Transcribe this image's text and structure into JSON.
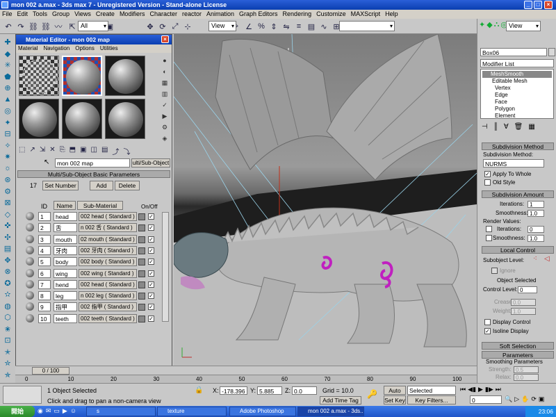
{
  "window": {
    "title": "mon 002 a.max - 3ds max 7 - Unregistered Version - Stand-alone License",
    "minimize": "_",
    "maximize": "□",
    "close": "×"
  },
  "menu": [
    "File",
    "Edit",
    "Tools",
    "Group",
    "Views",
    "Create",
    "Modifiers",
    "Character",
    "reactor",
    "Animation",
    "Graph Editors",
    "Rendering",
    "Customize",
    "MAXScript",
    "Help"
  ],
  "toolbar": {
    "selection_filter": "All",
    "reference_coord": "View",
    "named_selection": "",
    "right_view": "View",
    "icons": [
      "undo-icon",
      "redo-icon",
      "link-icon",
      "unlink-icon",
      "bind-space-warp-icon",
      "select-icon",
      "select-by-name-icon",
      "region-select-icon",
      "window-crossing-icon",
      "select-move-icon",
      "select-rotate-icon",
      "select-scale-icon",
      "pivot-icon",
      "select-manipulate-icon",
      "snap-icon",
      "angle-snap-icon",
      "percent-snap-icon",
      "spinner-snap-icon",
      "mirror-icon",
      "align-icon",
      "layer-manager-icon",
      "curve-editor-icon",
      "schematic-view-icon",
      "material-editor-icon",
      "render-scene-icon",
      "quick-render-icon"
    ]
  },
  "left_toolbar": [
    "tool-1",
    "tool-2",
    "tool-3",
    "tool-4",
    "tool-5",
    "tool-6",
    "tool-7",
    "tool-8",
    "tool-9",
    "tool-10",
    "tool-11",
    "tool-12",
    "tool-13",
    "tool-14",
    "tool-15",
    "tool-16",
    "tool-17",
    "tool-18",
    "tool-19",
    "tool-20",
    "tool-21",
    "tool-22",
    "tool-23",
    "tool-24",
    "tool-25",
    "tool-26",
    "tool-27",
    "tool-28",
    "tool-29",
    "tool-30"
  ],
  "material_editor": {
    "title": "Material Editor - mon 002 map",
    "menu": [
      "Material",
      "Navigation",
      "Options",
      "Utilities"
    ],
    "material_name": "mon 002 map",
    "material_type": "ulti/Sub-Object",
    "rollout": "Multi/Sub-Object Basic Parameters",
    "count": "17",
    "set_number": "Set Number",
    "add": "Add",
    "delete": "Delete",
    "col_id": "ID",
    "col_name": "Name",
    "col_submat": "Sub-Material",
    "col_onoff": "On/Off",
    "rows": [
      {
        "id": "1",
        "name": "head",
        "sub": "002 head  ( Standard )"
      },
      {
        "id": "2",
        "name": "舌",
        "sub": "n 002 舌  ( Standard )"
      },
      {
        "id": "3",
        "name": "mouth",
        "sub": "02 mouth  ( Standard )"
      },
      {
        "id": "4",
        "name": "牙肉",
        "sub": "002 牙肉  ( Standard )"
      },
      {
        "id": "5",
        "name": "body",
        "sub": "002 body  ( Standard )"
      },
      {
        "id": "6",
        "name": "wing",
        "sub": "002 wing  ( Standard )"
      },
      {
        "id": "7",
        "name": "hend",
        "sub": "002 head  ( Standard )"
      },
      {
        "id": "8",
        "name": "leg",
        "sub": "n 002 leg  ( Standard )"
      },
      {
        "id": "9",
        "name": "指甲",
        "sub": "002 指甲  ( Standard )"
      },
      {
        "id": "10",
        "name": "teeth",
        "sub": "002 teeth  ( Standard )"
      }
    ],
    "check": "✓"
  },
  "command_panel": {
    "object_name": "Box06",
    "modifier_list": "Modifier List",
    "stack": [
      "MeshSmooth",
      "Editable Mesh",
      "Vertex",
      "Edge",
      "Face",
      "Polygon",
      "Element"
    ],
    "subdiv_method_head": "Subdivision Method",
    "subdiv_method_label": "Subdivision Method:",
    "subdiv_method_value": "NURMS",
    "apply_to_whole": "Apply To Whole",
    "old_style": "Old Style",
    "subdiv_amount_head": "Subdivision Amount",
    "iterations_label": "Iterations:",
    "iterations_value": "1",
    "smoothness_label": "Smoothness:",
    "smoothness_value": "1.0",
    "render_values": "Render Values:",
    "render_iterations_value": "0",
    "render_smoothness_value": "1.0",
    "local_control_head": "Local Control",
    "subobject_level": "Subobject Level:",
    "ignore": "Ignore",
    "object_selected": "Object Selected",
    "control_level": "Control Level:",
    "control_level_value": "0",
    "crease": "Crease:",
    "crease_value": "0.0",
    "weight": "Weight:",
    "weight_value": "1.0",
    "display_control": "Display Control",
    "isoline_display": "Isoline Display",
    "soft_selection_head": "Soft Selection",
    "parameters_head": "Parameters",
    "smoothing_params": "Smoothing Parameters",
    "strength": "Strength:",
    "strength_value": "0.5",
    "relax": "Relax:",
    "relax_value": "0.0"
  },
  "timeline": {
    "slider": "0 / 100",
    "ticks": [
      "0",
      "10",
      "20",
      "30",
      "40",
      "50",
      "60",
      "70",
      "80",
      "90",
      "100"
    ]
  },
  "status": {
    "selected": "1 Object Selected",
    "prompt": "Click and drag to pan a non-camera view",
    "x_label": "X:",
    "x_value": "-178.396",
    "y_label": "Y:",
    "y_value": "5.885",
    "z_label": "Z:",
    "z_value": "0.0",
    "grid": "Grid = 10.0",
    "add_time_tag": "Add Time Tag",
    "auto_key": "Auto Key",
    "set_key": "Set Key",
    "key_mode": "Selected",
    "key_filters": "Key Filters...",
    "frame": "0"
  },
  "taskbar": {
    "start": "開始",
    "tasks": [
      "s",
      "texture",
      "Adobe Photoshop",
      "mon 002 a.max - 3ds..."
    ],
    "clock": "23:06"
  },
  "colors": {
    "titlebar": "#1547c0",
    "accent_orange": "#e07020",
    "dragon": "#b5b5b5",
    "magenta_marks": "#c020c0"
  }
}
